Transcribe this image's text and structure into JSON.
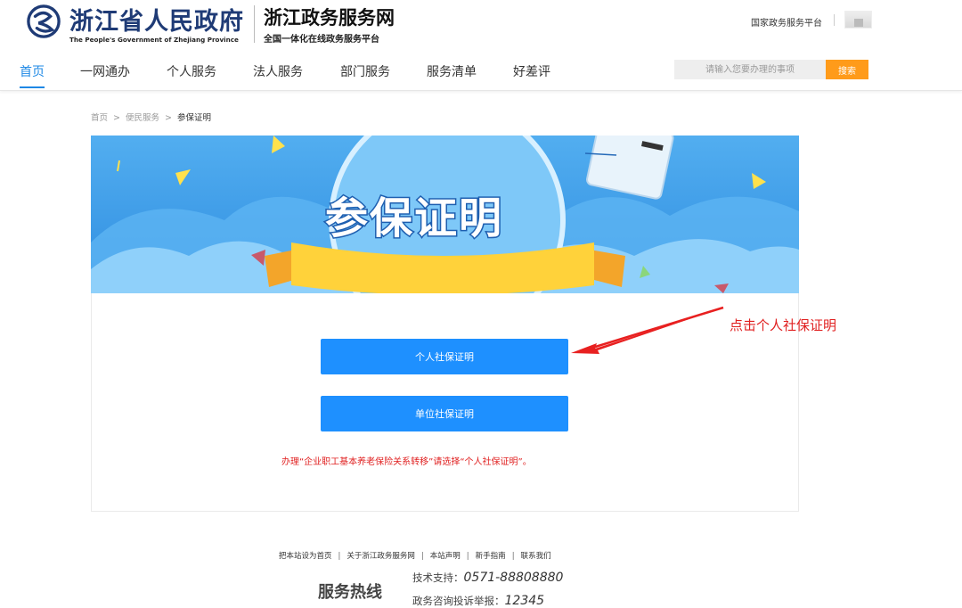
{
  "header": {
    "logo_cn": "浙江省人民政府",
    "logo_en": "The People's Government of Zhejiang Province",
    "portal_title": "浙江政务服务网",
    "portal_subtitle": "全国一体化在线政务服务平台",
    "national_link": "国家政务服务平台"
  },
  "nav": {
    "items": [
      {
        "label": "首页"
      },
      {
        "label": "一网通办"
      },
      {
        "label": "个人服务"
      },
      {
        "label": "法人服务"
      },
      {
        "label": "部门服务"
      },
      {
        "label": "服务清单"
      },
      {
        "label": "好差评"
      }
    ],
    "search_placeholder": "请输入您要办理的事项",
    "search_button": "搜索"
  },
  "breadcrumb": {
    "items": [
      "首页",
      "便民服务",
      "参保证明"
    ],
    "separator": ">"
  },
  "banner": {
    "title": "参保证明"
  },
  "content": {
    "personal_button": "个人社保证明",
    "company_button": "单位社保证明",
    "notice": "办理“企业职工基本养老保险关系转移”请选择“个人社保证明”。"
  },
  "annotation": {
    "text": "点击个人社保证明"
  },
  "footer": {
    "links": [
      "把本站设为首页",
      "关于浙江政务服务网",
      "本站声明",
      "新手指南",
      "联系我们"
    ],
    "link_separator": "|",
    "hotline_label": "服务热线",
    "tech_support_label": "技术支持：",
    "tech_support_number": "0571-88808880",
    "complaint_label": "政务咨询投诉举报：",
    "complaint_number": "12345"
  },
  "colors": {
    "accent": "#1e88e5",
    "button": "#1e90ff",
    "search_button": "#ff9b1a",
    "notice": "#e02020"
  }
}
